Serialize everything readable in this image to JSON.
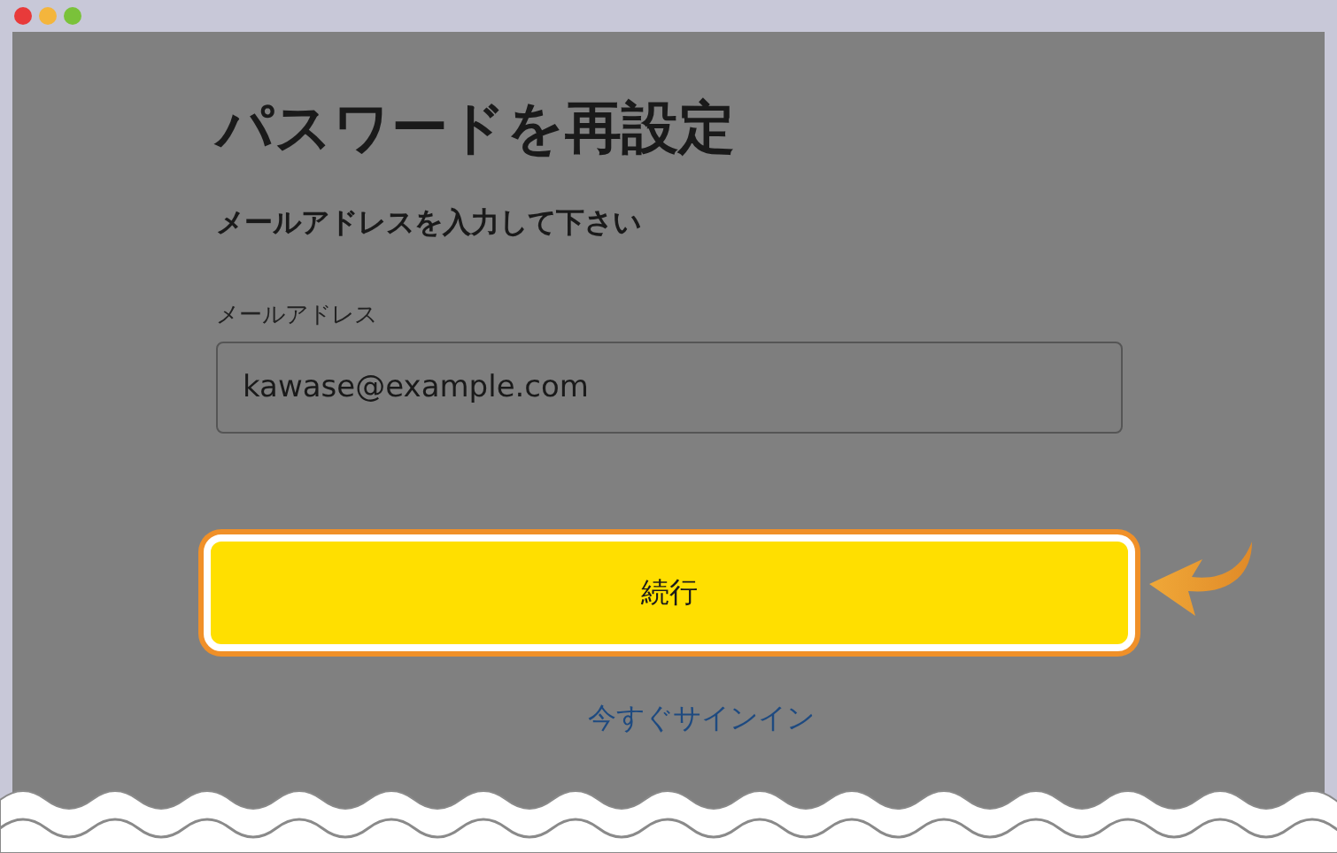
{
  "title": "パスワードを再設定",
  "instruction": "メールアドレスを入力して下さい",
  "email_field": {
    "label": "メールアドレス",
    "value": "kawase@example.com"
  },
  "continue_button": {
    "label": "続行",
    "highlighted": true
  },
  "sign_in_link": "今すぐサインイン"
}
